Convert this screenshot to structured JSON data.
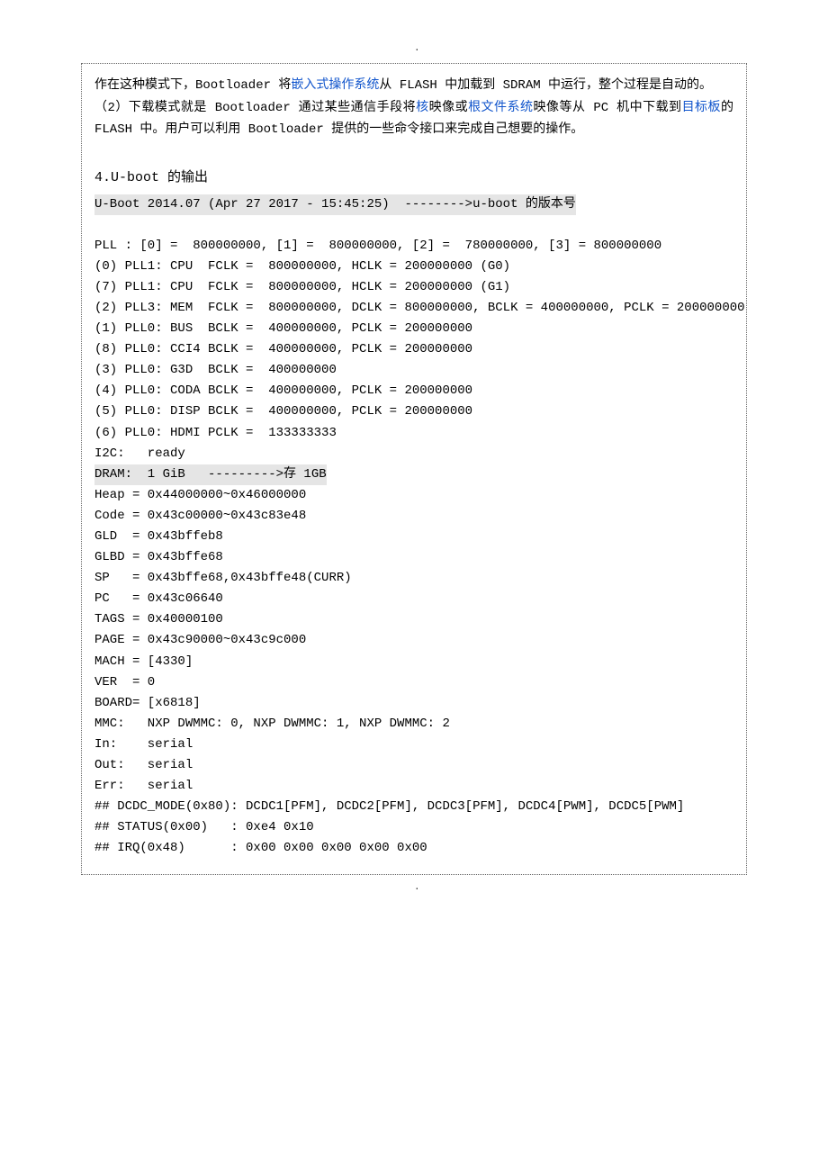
{
  "page_marker": ".",
  "intro": {
    "p1a": "作在这种模式下，Bootloader 将",
    "p1_link1": "嵌入式操作系统",
    "p1b": "从 FLASH 中加载到 SDRAM 中运行，整个过程是自动的。",
    "p2a": "（2）下载模式就是 Bootloader 通过某些通信手段将",
    "p2_link1": "核",
    "p2b": "映像或",
    "p2_link2": "根文件系统",
    "p2c": "映像等从 PC 机中下载到",
    "p2_link3": "目标板",
    "p2d": "的 FLASH 中。用户可以利用 Bootloader 提供的一些命令接口来完成自己想要的操作。"
  },
  "section_title": "4.U-boot 的输出",
  "console": {
    "l1": "U-Boot 2014.07 (Apr 27 2017 - 15:45:25)  -------->u-boot 的版本号",
    "l2": "",
    "l3": "PLL : [0] =  800000000, [1] =  800000000, [2] =  780000000, [3] = 800000000",
    "l4": "(0) PLL1: CPU  FCLK =  800000000, HCLK = 200000000 (G0)",
    "l5": "(7) PLL1: CPU  FCLK =  800000000, HCLK = 200000000 (G1)",
    "l6": "(2) PLL3: MEM  FCLK =  800000000, DCLK = 800000000, BCLK = 400000000, PCLK = 200000000",
    "l7": "(1) PLL0: BUS  BCLK =  400000000, PCLK = 200000000",
    "l8": "(8) PLL0: CCI4 BCLK =  400000000, PCLK = 200000000",
    "l9": "(3) PLL0: G3D  BCLK =  400000000",
    "l10": "(4) PLL0: CODA BCLK =  400000000, PCLK = 200000000",
    "l11": "(5) PLL0: DISP BCLK =  400000000, PCLK = 200000000",
    "l12": "(6) PLL0: HDMI PCLK =  133333333",
    "l13": "I2C:   ready",
    "l14": "DRAM:  1 GiB   --------->存 1GB",
    "l15": "Heap = 0x44000000~0x46000000",
    "l16": "Code = 0x43c00000~0x43c83e48",
    "l17": "GLD  = 0x43bffeb8",
    "l18": "GLBD = 0x43bffe68",
    "l19": "SP   = 0x43bffe68,0x43bffe48(CURR)",
    "l20": "PC   = 0x43c06640",
    "l21": "TAGS = 0x40000100",
    "l22": "PAGE = 0x43c90000~0x43c9c000",
    "l23": "MACH = [4330]",
    "l24": "VER  = 0",
    "l25": "BOARD= [x6818]",
    "l26": "MMC:   NXP DWMMC: 0, NXP DWMMC: 1, NXP DWMMC: 2",
    "l27": "In:    serial",
    "l28": "Out:   serial",
    "l29": "Err:   serial",
    "l30": "## DCDC_MODE(0x80): DCDC1[PFM], DCDC2[PFM], DCDC3[PFM], DCDC4[PWM], DCDC5[PWM]",
    "l31": "## STATUS(0x00)   : 0xe4 0x10",
    "l32": "## IRQ(0x48)      : 0x00 0x00 0x00 0x00 0x00"
  }
}
